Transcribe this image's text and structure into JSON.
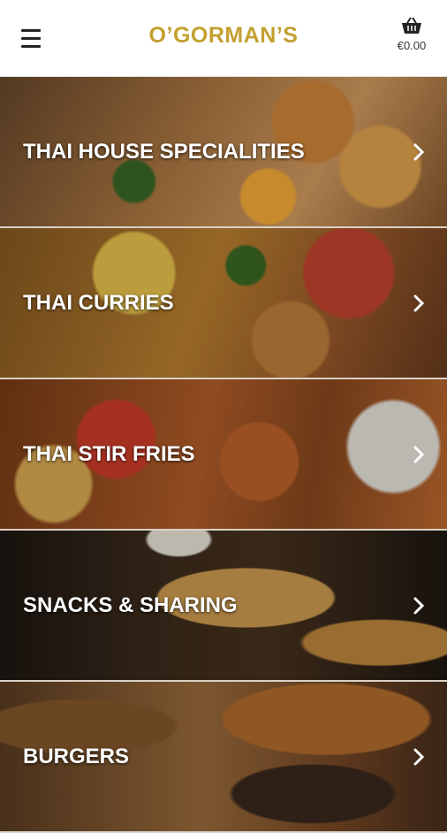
{
  "header": {
    "brand": "O’GORMAN’S",
    "cart_total": "€0.00",
    "menu_icon": "hamburger-menu-icon",
    "cart_icon": "shopping-basket-icon",
    "brand_color": "#c4a030"
  },
  "categories": [
    {
      "label": "THAI HOUSE SPECIALITIES",
      "icon": "chevron-right-icon"
    },
    {
      "label": "THAI CURRIES",
      "icon": "chevron-right-icon"
    },
    {
      "label": "THAI STIR FRIES",
      "icon": "chevron-right-icon"
    },
    {
      "label": "SNACKS & SHARING",
      "icon": "chevron-right-icon"
    },
    {
      "label": "BURGERS",
      "icon": "chevron-right-icon"
    }
  ]
}
